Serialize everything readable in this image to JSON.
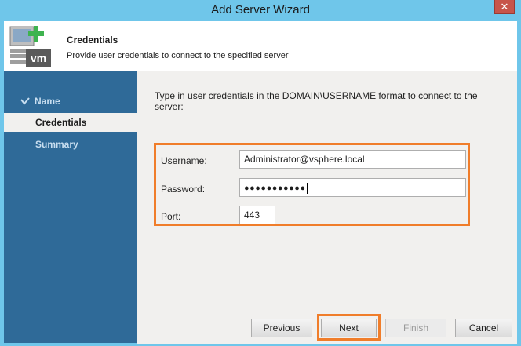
{
  "window": {
    "title": "Add Server Wizard",
    "close_glyph": "✕"
  },
  "header": {
    "icon": "server-add-vm-icon",
    "icon_text": "vm",
    "title": "Credentials",
    "subtitle": "Provide user credentials to connect to the specified server"
  },
  "sidebar": {
    "items": [
      {
        "label": "Name",
        "state": "completed",
        "icon": "checkmark-icon"
      },
      {
        "label": "Credentials",
        "state": "active"
      },
      {
        "label": "Summary",
        "state": "pending"
      }
    ]
  },
  "form": {
    "instructions": "Type in user credentials in the DOMAIN\\USERNAME format to connect to the server:",
    "username_label": "Username:",
    "username_value": "Administrator@vsphere.local",
    "password_label": "Password:",
    "password_masked": "●●●●●●●●●●●",
    "port_label": "Port:",
    "port_value": "443"
  },
  "buttons": {
    "previous": "Previous",
    "next": "Next",
    "finish": "Finish",
    "cancel": "Cancel"
  },
  "colors": {
    "titlebar": "#6fc6ea",
    "sidebar": "#2f6a98",
    "highlight": "#f07d2a",
    "close_button": "#c7554a"
  }
}
